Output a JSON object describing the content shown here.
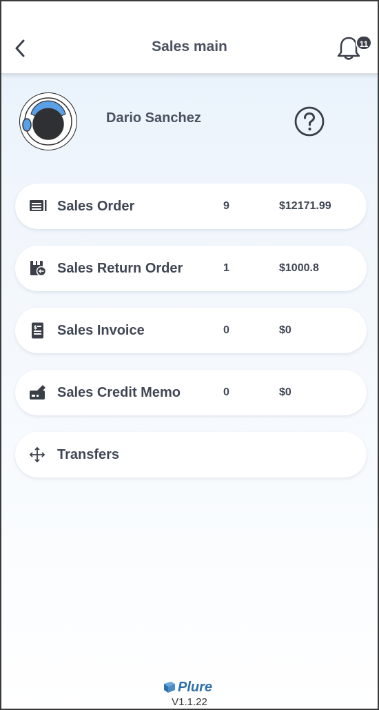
{
  "header": {
    "title": "Sales main",
    "back_icon": "chevron-left-icon",
    "notification_icon": "bell-icon",
    "notification_count": "11"
  },
  "user": {
    "name": "Dario Sanchez",
    "avatar_icon": "astronaut-helmet-icon",
    "help_icon": "question-circle-icon"
  },
  "menu": [
    {
      "icon": "list-icon",
      "label": "Sales Order",
      "count": "9",
      "amount": "$12171.99"
    },
    {
      "icon": "return-order-icon",
      "label": "Sales Return Order",
      "count": "1",
      "amount": "$1000.8"
    },
    {
      "icon": "invoice-icon",
      "label": "Sales Invoice",
      "count": "0",
      "amount": "$0"
    },
    {
      "icon": "credit-card-icon",
      "label": "Sales Credit Memo",
      "count": "0",
      "amount": "$0"
    },
    {
      "icon": "move-arrows-icon",
      "label": "Transfers"
    }
  ],
  "footer": {
    "logo_text": "Plure",
    "version": "V1.1.22"
  },
  "colors": {
    "text": "#3f4654",
    "accent_blue": "#5aa0e6",
    "badge_bg": "#3b3f48"
  }
}
